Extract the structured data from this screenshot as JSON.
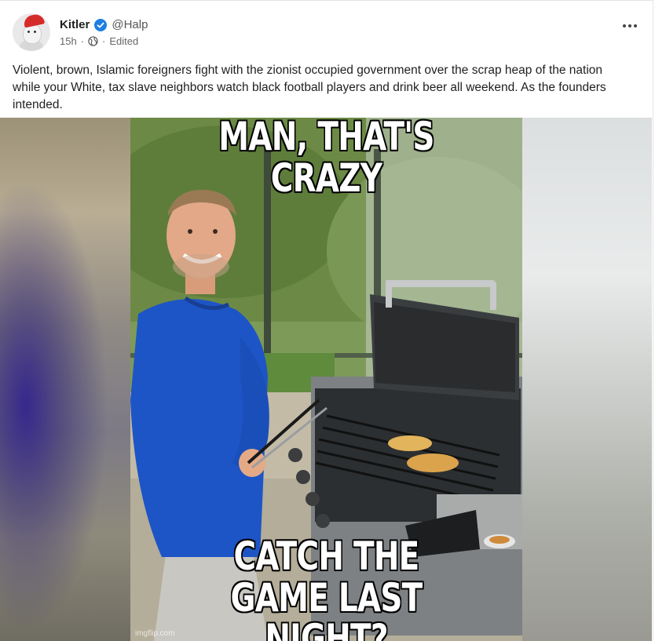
{
  "post": {
    "author_name": "Kitler",
    "author_handle": "@Halp",
    "time": "15h",
    "separator": "·",
    "edited_label": "Edited",
    "text": "Violent, brown, Islamic foreigners fight with the zionist occupied government over the scrap heap of the nation while your White, tax slave neighbors watch black football players and drink beer all weekend. As the founders intended.",
    "verified_color": "#1d7fe0"
  },
  "meme": {
    "top_caption": "MAN, THAT'S CRAZY",
    "bottom_caption_line1": "CATCH THE",
    "bottom_caption_line2": "GAME LAST NIGHT?",
    "watermark": "imgflip.com"
  },
  "icons": {
    "verified": "verified-badge-icon",
    "globe": "globe-icon",
    "more": "more-options-icon"
  }
}
